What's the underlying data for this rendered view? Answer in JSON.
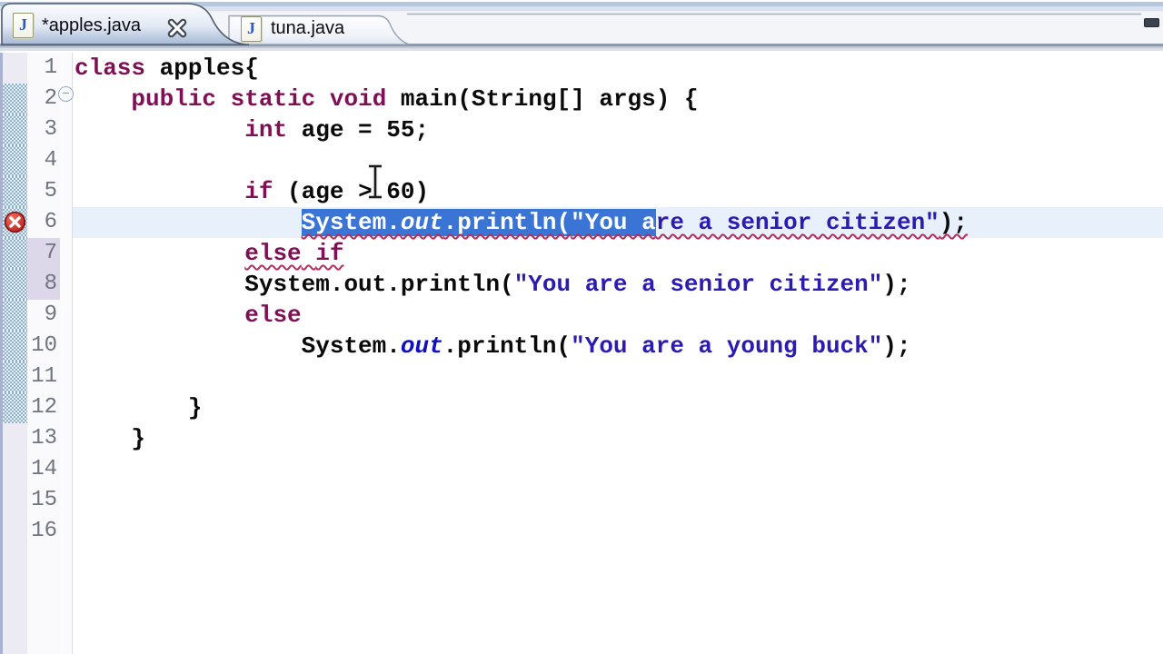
{
  "tabs": [
    {
      "label": "*apples.java",
      "active": true,
      "dirty": true,
      "closable": true
    },
    {
      "label": "tuna.java",
      "active": false,
      "dirty": false,
      "closable": false
    }
  ],
  "icons": {
    "java_file_icon": "J",
    "close_icon": "✕",
    "fold_collapse_icon": "−",
    "error_icon": "✕",
    "minimize_icon": "▭",
    "text_cursor": "I-beam"
  },
  "editor": {
    "current_line": 6,
    "error_line": 6,
    "fold_line": 2,
    "changed_lines": [
      7,
      8
    ],
    "range_indicator": {
      "from_line": 2,
      "to_line": 12
    },
    "selection": {
      "line": 6,
      "selected_text": "System.out.println(\"You a"
    },
    "lines": [
      {
        "num": 1,
        "indent": 0,
        "tokens": [
          {
            "t": "class",
            "c": "k"
          },
          {
            "t": " apples{",
            "c": "p"
          }
        ]
      },
      {
        "num": 2,
        "indent": 1,
        "fold": true,
        "tokens": [
          {
            "t": "public",
            "c": "k"
          },
          {
            "t": " ",
            "c": "p"
          },
          {
            "t": "static",
            "c": "k"
          },
          {
            "t": " ",
            "c": "p"
          },
          {
            "t": "void",
            "c": "k"
          },
          {
            "t": " main(String[] args) {",
            "c": "p"
          }
        ]
      },
      {
        "num": 3,
        "indent": 3,
        "tokens": [
          {
            "t": "int",
            "c": "k"
          },
          {
            "t": " age = 55;",
            "c": "p"
          }
        ]
      },
      {
        "num": 4,
        "indent": 0,
        "tokens": []
      },
      {
        "num": 5,
        "indent": 3,
        "tokens": [
          {
            "t": "if",
            "c": "k"
          },
          {
            "t": " (age > 60)",
            "c": "p"
          }
        ]
      },
      {
        "num": 6,
        "indent": 4,
        "squiggle": true,
        "tokens": [
          {
            "t": "System.",
            "c": "p",
            "sel": true
          },
          {
            "t": "out",
            "c": "f",
            "sel": true
          },
          {
            "t": ".println(",
            "c": "p",
            "sel": true
          },
          {
            "t": "\"You a",
            "c": "s",
            "sel": true
          },
          {
            "t": "re a senior citizen\"",
            "c": "s"
          },
          {
            "t": ");",
            "c": "p"
          }
        ]
      },
      {
        "num": 7,
        "indent": 3,
        "squiggle": true,
        "tokens": [
          {
            "t": "else",
            "c": "k"
          },
          {
            "t": " ",
            "c": "p"
          },
          {
            "t": "if",
            "c": "k"
          }
        ]
      },
      {
        "num": 8,
        "indent": 3,
        "tokens": [
          {
            "t": "System.out.println(",
            "c": "p"
          },
          {
            "t": "\"You are a senior citizen\"",
            "c": "s"
          },
          {
            "t": ");",
            "c": "p"
          }
        ]
      },
      {
        "num": 9,
        "indent": 3,
        "tokens": [
          {
            "t": "else",
            "c": "k"
          }
        ]
      },
      {
        "num": 10,
        "indent": 4,
        "tokens": [
          {
            "t": "System.",
            "c": "p"
          },
          {
            "t": "out",
            "c": "f"
          },
          {
            "t": ".println(",
            "c": "p"
          },
          {
            "t": "\"You are a young buck\"",
            "c": "s"
          },
          {
            "t": ");",
            "c": "p"
          }
        ]
      },
      {
        "num": 11,
        "indent": 0,
        "tokens": []
      },
      {
        "num": 12,
        "indent": 2,
        "tokens": [
          {
            "t": "}",
            "c": "p"
          }
        ]
      },
      {
        "num": 13,
        "indent": 1,
        "tokens": [
          {
            "t": "}",
            "c": "p"
          }
        ]
      },
      {
        "num": 14,
        "indent": 0,
        "tokens": []
      },
      {
        "num": 15,
        "indent": 0,
        "tokens": []
      },
      {
        "num": 16,
        "indent": 0,
        "tokens": []
      }
    ]
  },
  "colors": {
    "selection_bg": "#3A74D4",
    "current_line_bg": "#E8F0FB",
    "keyword": "#7F1055",
    "string": "#2B1BB2",
    "field_italic": "#0F0FBF",
    "error_red": "#C41616",
    "squiggle": "#B03060",
    "range_indicator_blue": "#8FB2CB",
    "changed_line_bg": "#DDD7EA",
    "line_number_gray": "#6F7480",
    "tab_separator_gray": "#8F99AD"
  }
}
